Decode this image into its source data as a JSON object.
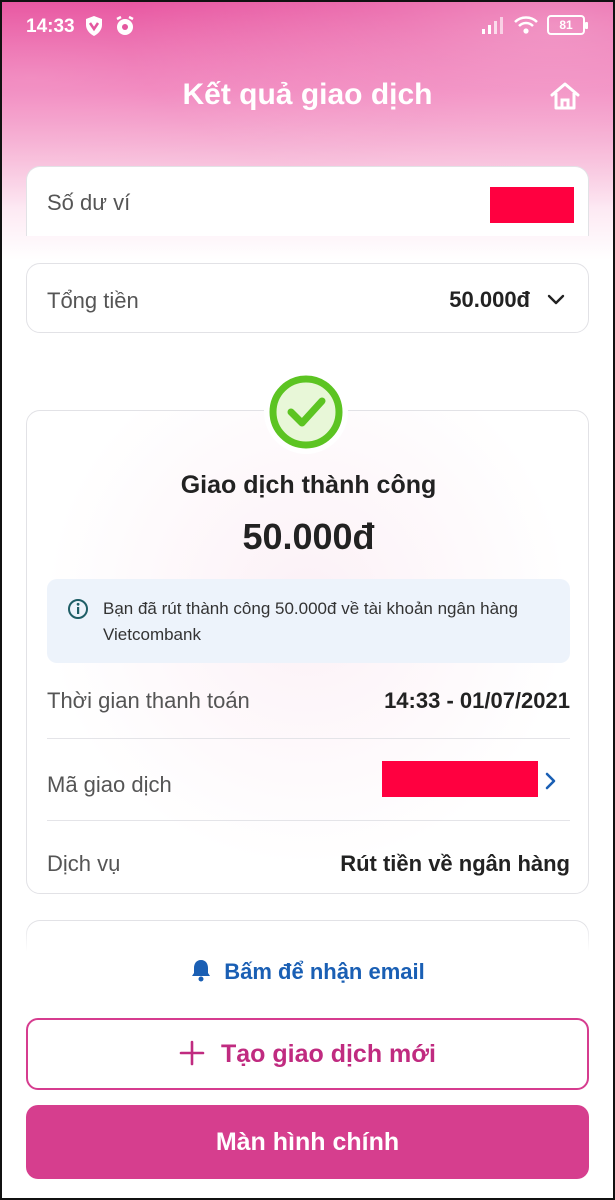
{
  "status_bar": {
    "time": "14:33",
    "battery": "81"
  },
  "header": {
    "title": "Kết quả giao dịch"
  },
  "balance": {
    "label": "Số dư ví"
  },
  "total": {
    "label": "Tổng tiền",
    "value": "50.000đ"
  },
  "result": {
    "title": "Giao dịch thành công",
    "amount": "50.000đ",
    "info": "Bạn đã rút thành công 50.000đ về tài khoản ngân hàng Vietcombank",
    "rows": [
      {
        "label": "Thời gian thanh toán",
        "value": "14:33 - 01/07/2021"
      },
      {
        "label": "Mã giao dịch"
      },
      {
        "label": "Dịch vụ",
        "value": "Rút tiền về ngân hàng"
      }
    ]
  },
  "actions": {
    "email_link": "Bấm để nhận email",
    "new_transaction": "Tạo giao dịch mới",
    "home_screen": "Màn hình chính"
  },
  "colors": {
    "brand_pink": "#d63e8e",
    "success_green": "#5cc422",
    "link_blue": "#1a5fb4",
    "redaction": "#ff0040"
  }
}
